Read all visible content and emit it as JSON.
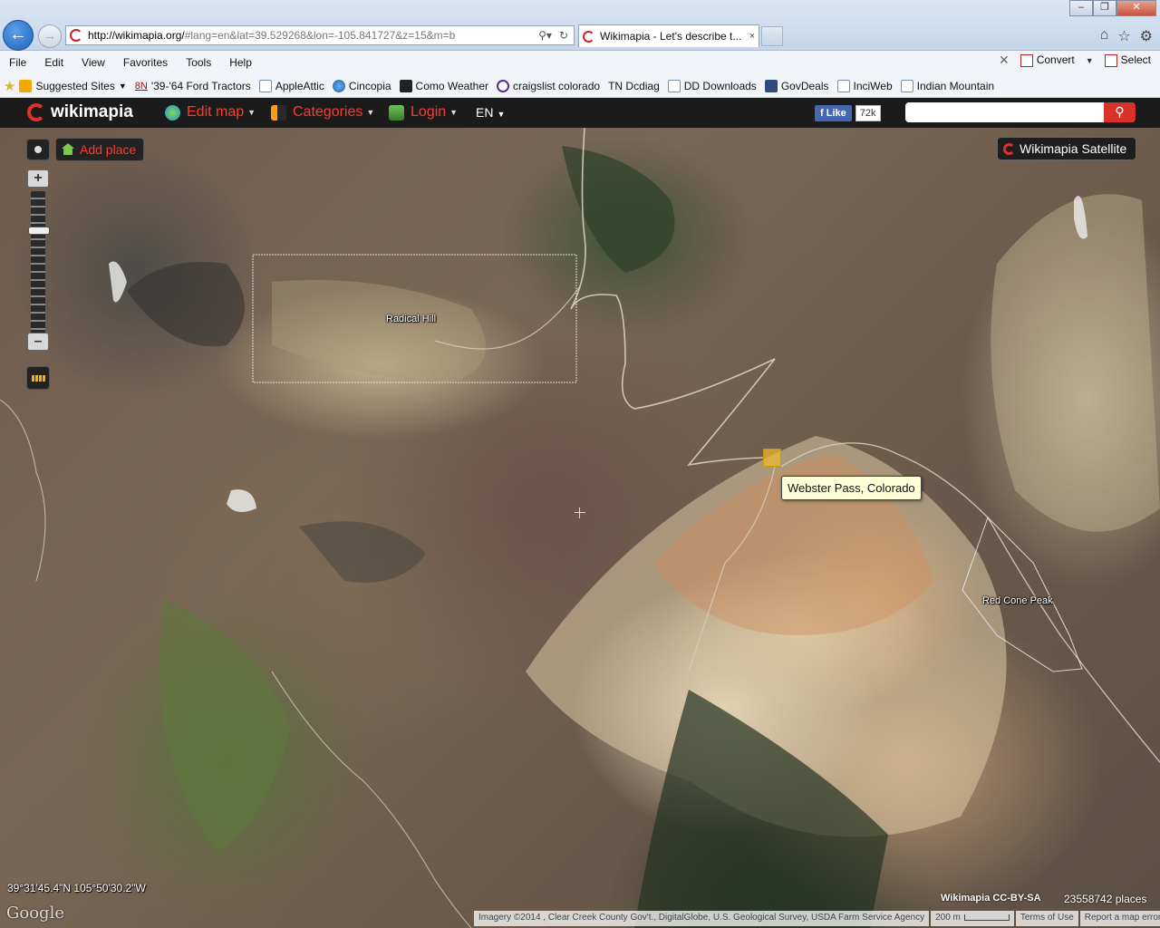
{
  "browser": {
    "url_host": "http://wikimapia.org/",
    "url_rest": "#lang=en&lat=39.529268&lon=-105.841727&z=15&m=b",
    "tab_title": "Wikimapia - Let's describe t...",
    "tab_close": "×",
    "menu": [
      "File",
      "Edit",
      "View",
      "Favorites",
      "Tools",
      "Help"
    ],
    "convert_label": "Convert",
    "select_label": "Select",
    "favorites": {
      "suggested": "Suggested Sites",
      "eight_n": "8N",
      "items": [
        "'39-'64 Ford Tractors",
        "AppleAttic",
        "Cincopia",
        "Como Weather",
        "craigslist colorado",
        "TN Dcdiag",
        "DD Downloads",
        "GovDeals",
        "InciWeb",
        "Indian Mountain"
      ]
    }
  },
  "wikimapia": {
    "logo": "wikimapia",
    "nav": {
      "edit_map": "Edit map",
      "categories": "Categories",
      "login": "Login",
      "lang": "EN"
    },
    "fb_like": "Like",
    "fb_count": "72k",
    "search_placeholder": "",
    "add_place": "Add place",
    "layer": "Wikimapia Satellite"
  },
  "map": {
    "places": {
      "radical_hill": "Radical Hill",
      "red_cone_peak": "Red Cone Peak"
    },
    "tooltip": "Webster Pass, Colorado",
    "coordinates": "39°31'45.4\"N 105°50'30.2\"W",
    "google": "Google",
    "license": "Wikimapia CC-BY-SA",
    "places_count": "23558742 places",
    "attribution": {
      "imagery": "Imagery ©2014 , Clear Creek County Gov't., DigitalGlobe, U.S. Geological Survey, USDA Farm Service Agency",
      "scale": "200 m",
      "terms": "Terms of Use",
      "report": "Report a map error"
    }
  }
}
